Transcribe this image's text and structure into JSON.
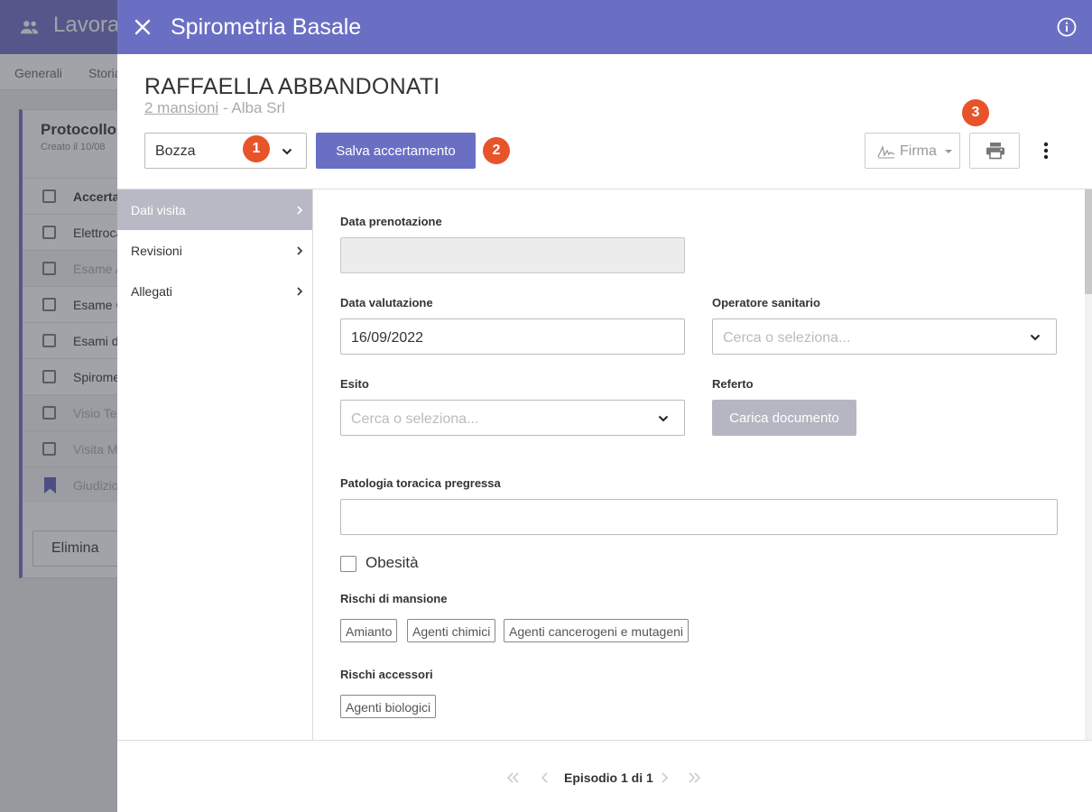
{
  "background": {
    "app_title": "Lavora",
    "tabs": [
      "Generali",
      "Storia"
    ],
    "card": {
      "title": "Protocollo",
      "subtitle": "Creato il 10/08",
      "header_label": "Accertam",
      "rows": [
        "Elettroca",
        "Esame A",
        "Esame C",
        "Esami de",
        "Spirome",
        "Visio Tes",
        "Visita M",
        "Giudizio"
      ]
    },
    "delete_label": "Elimina"
  },
  "modal": {
    "title": "Spirometria Basale",
    "patient": {
      "name": "RAFFAELLA ABBANDONATI",
      "mansioni_link": "2 mansioni",
      "separator": " - ",
      "company": "Alba Srl"
    },
    "status_select": {
      "value": "Bozza"
    },
    "badges": [
      "1",
      "2",
      "3"
    ],
    "save_label": "Salva accertamento",
    "firma_label": "Firma",
    "nav": [
      {
        "label": "Dati visita"
      },
      {
        "label": "Revisioni"
      },
      {
        "label": "Allegati"
      }
    ],
    "form": {
      "data_prenotazione": {
        "label": "Data prenotazione",
        "value": ""
      },
      "data_valutazione": {
        "label": "Data valutazione",
        "value": "16/09/2022"
      },
      "operatore": {
        "label": "Operatore sanitario",
        "placeholder": "Cerca o seleziona..."
      },
      "esito": {
        "label": "Esito",
        "placeholder": "Cerca o seleziona..."
      },
      "referto": {
        "label": "Referto",
        "button": "Carica documento"
      },
      "patologia": {
        "label": "Patologia toracica pregressa",
        "value": ""
      },
      "obesita": {
        "label": "Obesità",
        "checked": false
      },
      "rischi_mansione": {
        "label": "Rischi di mansione",
        "tags": [
          "Amianto",
          "Agenti chimici",
          "Agenti cancerogeni e mutageni"
        ]
      },
      "rischi_accessori": {
        "label": "Rischi accessori",
        "tags": [
          "Agenti biologici"
        ]
      }
    },
    "pagination": {
      "text": "Episodio 1 di 1"
    }
  },
  "colors": {
    "primary": "#6b6fc4",
    "badge": "#e8532a",
    "nav_active": "#b9b9c6",
    "upload_button": "#b5b6c2"
  }
}
